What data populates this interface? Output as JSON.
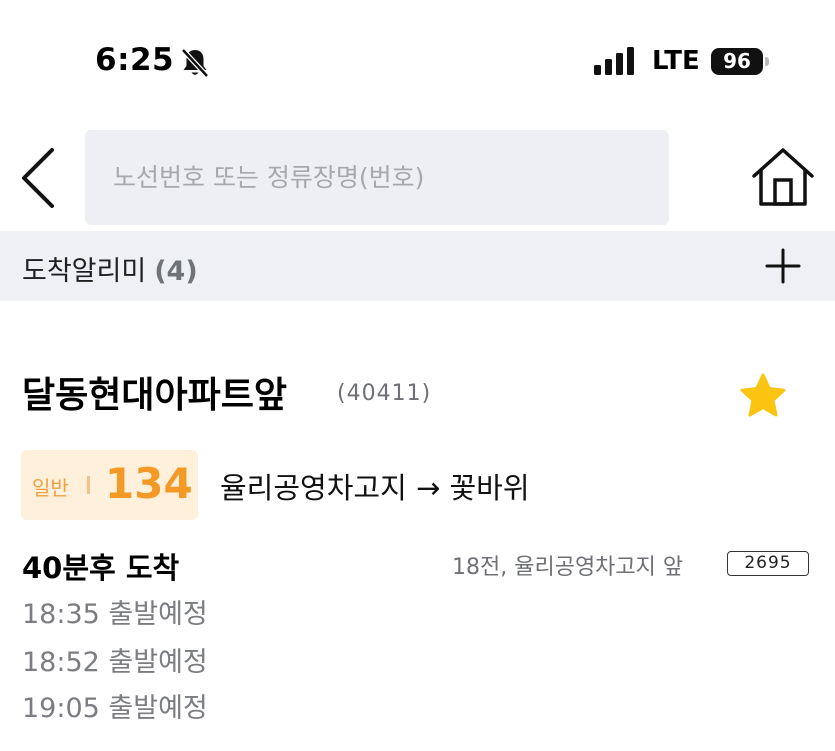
{
  "status_bar": {
    "time": "6:25",
    "network": "LTE",
    "battery": "96"
  },
  "search": {
    "placeholder": "노선번호 또는 정류장명(번호)"
  },
  "alerts": {
    "label": "도착알리미",
    "count": "(4)"
  },
  "stop": {
    "name": "달동현대아파트앞",
    "id": "(40411)",
    "favorited": true
  },
  "route": {
    "type": "일반",
    "number": "134",
    "direction": "율리공영차고지 → 꽃바위",
    "accent_color": "#f39a26",
    "badge_bg": "#fff0dc"
  },
  "arrival": {
    "main": "40분후 도착",
    "location": "18전, 율리공영차고지 앞",
    "plate": "2695"
  },
  "schedule": [
    "18:35 출발예정",
    "18:52 출발예정",
    "19:05 출발예정"
  ]
}
